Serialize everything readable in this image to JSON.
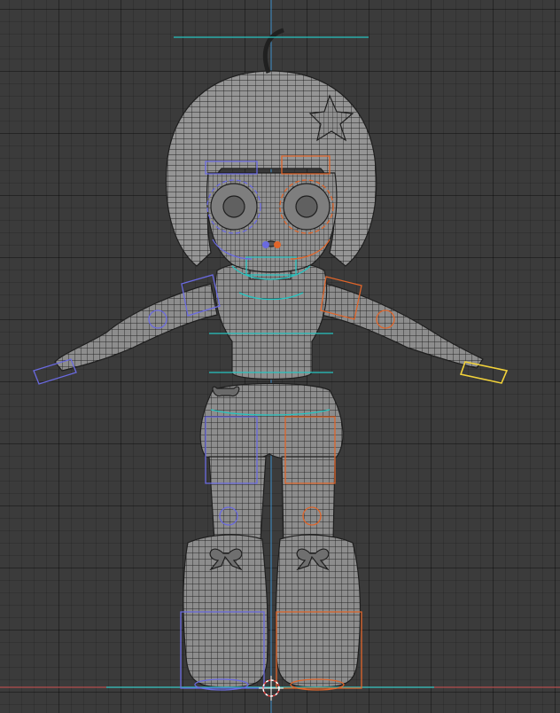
{
  "viewport": {
    "background": "#3b3b3b",
    "grid_color": "#2f2f2f",
    "axis_x_color": "#b24d4d",
    "axis_z_color": "#3f8fc9",
    "bone_color": "#26c4c0",
    "left_side_color": "#6a6ae0",
    "right_side_color": "#e0652a",
    "selected_color": "#f2d23a",
    "mesh_fill": "#8a8a8a",
    "wire_color": "#1e1e1e"
  },
  "scene": {
    "object": "chibi-girl-character-mesh",
    "shading": "wireframe-overlay",
    "view": "front-orthographic",
    "armature": "visible",
    "selected_control": "right-hand-control"
  }
}
